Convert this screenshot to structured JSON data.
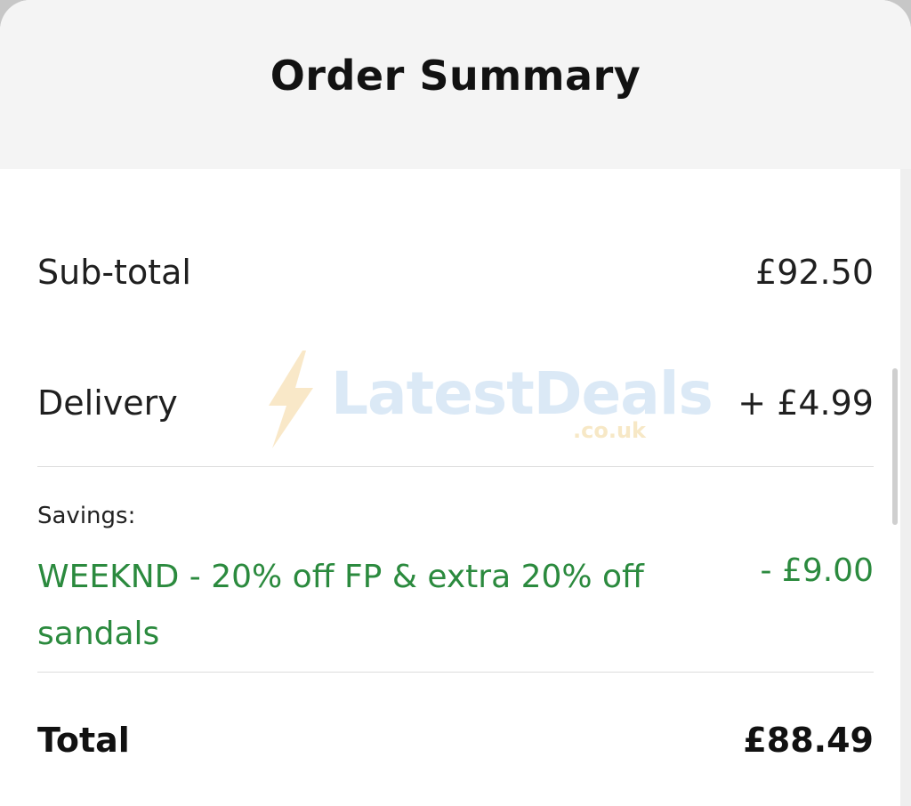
{
  "title": "Order Summary",
  "rows": {
    "subtotal": {
      "label": "Sub-total",
      "amount": "£92.50"
    },
    "delivery": {
      "label": "Delivery",
      "amount": "+ £4.99"
    },
    "total": {
      "label": "Total",
      "amount": "£88.49"
    }
  },
  "savings": {
    "heading": "Savings:",
    "description": "WEEKND - 20% off FP & extra 20% off sandals",
    "amount": "- £9.00"
  },
  "watermark": {
    "brand": "LatestDeals",
    "domain": ".co.uk",
    "icon": "lightning-bolt-icon"
  },
  "colors": {
    "savings": "#2b8a3e",
    "header_background": "#f4f4f4",
    "text": "#1f1f1f"
  }
}
